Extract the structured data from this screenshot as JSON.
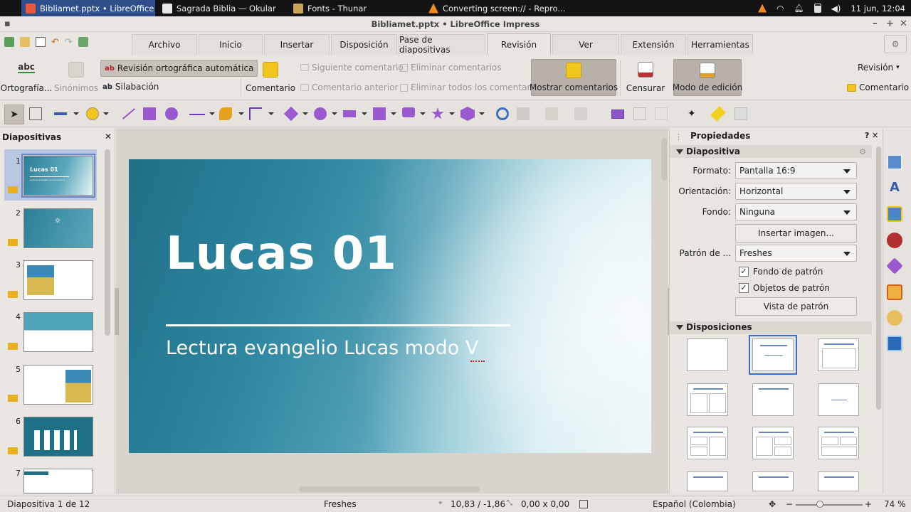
{
  "taskbar": {
    "tasks": [
      {
        "label": "Bibliamet.pptx • LibreOffice ..."
      },
      {
        "label": "Sagrada Biblia  — Okular"
      },
      {
        "label": "Fonts - Thunar"
      },
      {
        "label": "Converting screen:// - Repro..."
      }
    ],
    "clock": "11 jun, 12:04"
  },
  "window": {
    "title": "Bibliamet.pptx • LibreOffice Impress"
  },
  "tabs": [
    {
      "label": "Archivo"
    },
    {
      "label": "Inicio"
    },
    {
      "label": "Insertar"
    },
    {
      "label": "Disposición"
    },
    {
      "label": "Pase de diapositivas"
    },
    {
      "label": "Revisión"
    },
    {
      "label": "Ver"
    },
    {
      "label": "Extensión"
    },
    {
      "label": "Herramientas"
    }
  ],
  "ribbon": {
    "ortografia": "Ortografía...",
    "sinonimos": "Sinónimos",
    "revision_auto": "Revisión ortográfica automática",
    "silabacion": "Silabación",
    "comentario": "Comentario",
    "siguiente_comentario": "Siguiente comentario",
    "comentario_anterior": "Comentario anterior",
    "eliminar_comentarios": "Eliminar comentarios",
    "eliminar_todos": "Eliminar todos los comentarios",
    "mostrar_comentarios": "Mostrar comentarios",
    "censurar": "Censurar",
    "modo_edicion": "Modo de edición",
    "revision_menu": "Revisión",
    "comentario_right": "Comentario"
  },
  "slides_panel": {
    "title": "Diapositivas",
    "thumbs": [
      {
        "num": "1",
        "title": "Lucas 01",
        "sub": "Lectura evangelio Lucas modo V"
      },
      {
        "num": "2"
      },
      {
        "num": "3"
      },
      {
        "num": "4"
      },
      {
        "num": "5"
      },
      {
        "num": "6"
      },
      {
        "num": "7"
      }
    ]
  },
  "slide": {
    "title": "Lucas 01",
    "subtitle": "Lectura evangelio Lucas modo V"
  },
  "properties": {
    "header": "Propiedades",
    "section_slide": "Diapositiva",
    "formato_label": "Formato:",
    "formato_value": "Pantalla 16:9",
    "orientacion_label": "Orientación:",
    "orientacion_value": "Horizontal",
    "fondo_label": "Fondo:",
    "fondo_value": "Ninguna",
    "insertar_imagen": "Insertar imagen...",
    "patron_label": "Patrón de ...",
    "patron_value": "Freshes",
    "fondo_patron": "Fondo de patrón",
    "objetos_patron": "Objetos de patrón",
    "vista_patron": "Vista de patrón",
    "section_layouts": "Disposiciones",
    "fondo_patron_checked": true,
    "objetos_patron_checked": true
  },
  "status": {
    "slide_info": "Diapositiva 1 de 12",
    "master": "Freshes",
    "position": "10,83 / -1,86",
    "size": "0,00 x 0,00",
    "language": "Español (Colombia)",
    "zoom": "74 %"
  },
  "colors": {
    "accent": "#3f6fc4",
    "slide_teal": "#2e86a0",
    "taskbar": "#141414"
  }
}
